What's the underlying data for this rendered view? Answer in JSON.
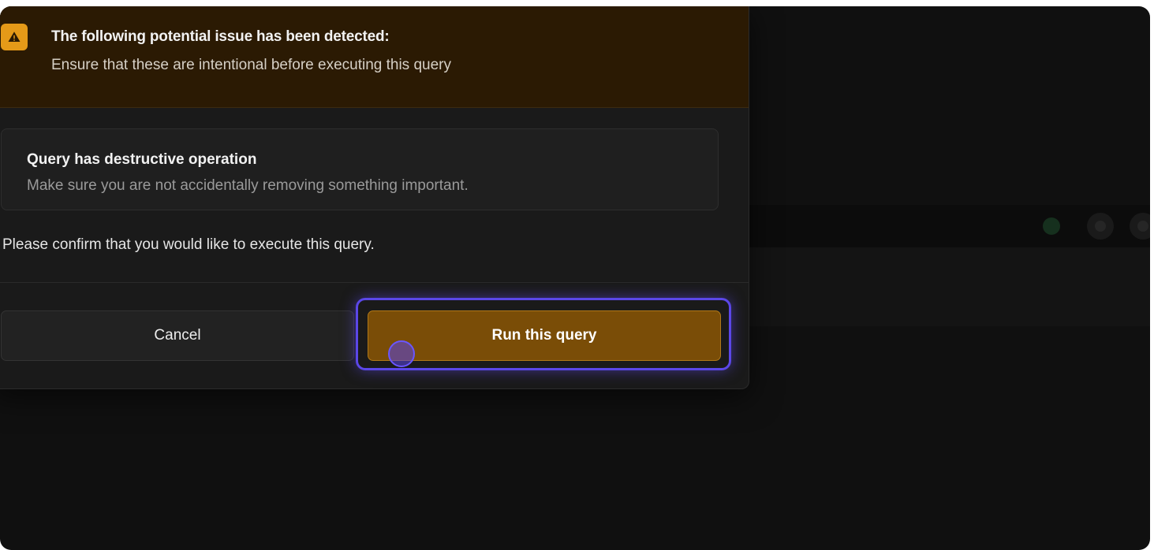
{
  "alert": {
    "icon": "warning-triangle-icon",
    "title": "The following potential issue has been detected:",
    "subtitle": "Ensure that these are intentional before executing this query",
    "accent_color": "#e59a18"
  },
  "issue": {
    "title": "Query has destructive operation",
    "description": "Make sure you are not accidentally removing something important."
  },
  "confirm_text": "Please confirm that you would like to execute this query.",
  "buttons": {
    "cancel_label": "Cancel",
    "run_label": "Run this query"
  },
  "colors": {
    "run_button": "#7a4d07",
    "focus_ring": "#5b47e8"
  }
}
